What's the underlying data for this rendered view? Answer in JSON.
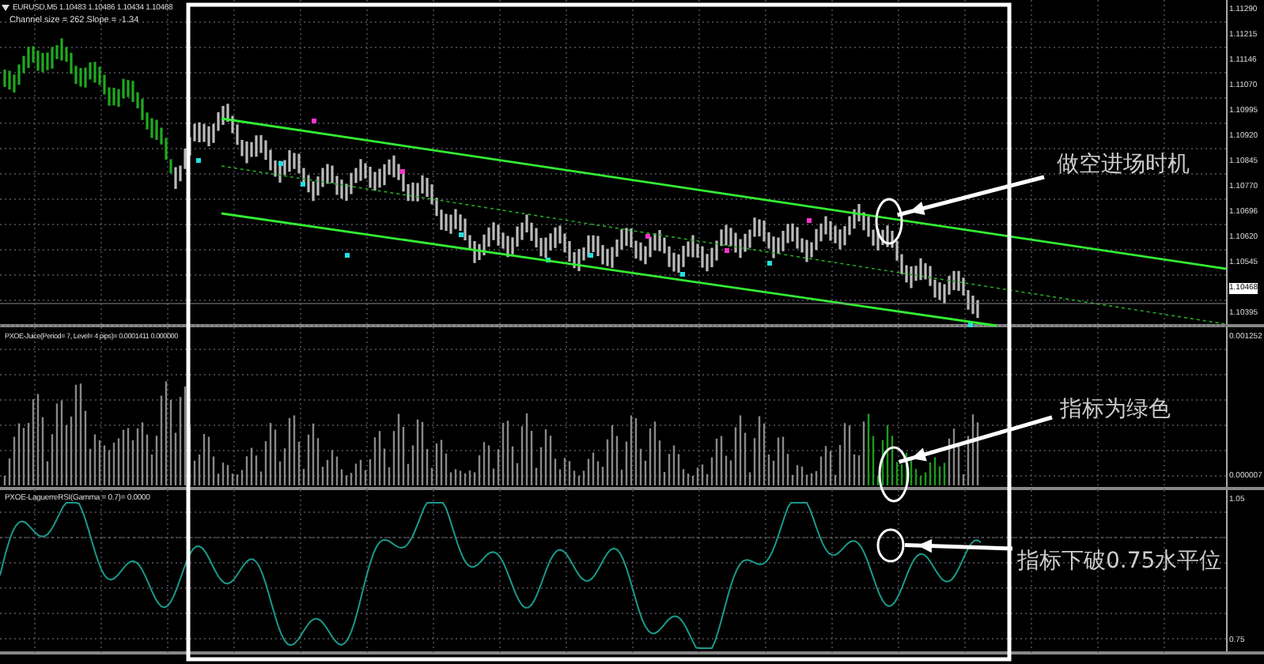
{
  "main_chart": {
    "title": "EURUSD,M5  1.10483 1.10486 1.10434 1.10468",
    "subtitle": "Channel size = 262 Slope = -1.34",
    "axis": [
      {
        "label": "1.11290",
        "kind": "tick"
      },
      {
        "label": "1.11215",
        "kind": "tick"
      },
      {
        "label": "1.11146",
        "kind": "tick"
      },
      {
        "label": "1.11070",
        "kind": "tick"
      },
      {
        "label": "1.10995",
        "kind": "tick"
      },
      {
        "label": "1.10920",
        "kind": "tick"
      },
      {
        "label": "1.10845",
        "kind": "tick"
      },
      {
        "label": "1.10770",
        "kind": "tick"
      },
      {
        "label": "1.10696",
        "kind": "tick"
      },
      {
        "label": "1.10620",
        "kind": "tick"
      },
      {
        "label": "1.10545",
        "kind": "tick"
      },
      {
        "label": "1.10468",
        "kind": "current"
      },
      {
        "label": "1.10395",
        "kind": "tick"
      }
    ]
  },
  "juice_pane": {
    "title": "PXOE-Juice(Period= 7, Level= 4 pips)= 0.0001411 0.000000",
    "axis": [
      {
        "label": "0.001252"
      },
      {
        "label": "0.000007"
      }
    ]
  },
  "laguerre_pane": {
    "title": "PXOE-LaguerreRSI(Gamma = 0.7)= 0.0000",
    "axis": [
      {
        "label": "1.05"
      },
      {
        "label": "0.75"
      }
    ]
  },
  "annotations": [
    "做空进场时机",
    "指标为绿色",
    "指标下破0.75水平位"
  ]
}
